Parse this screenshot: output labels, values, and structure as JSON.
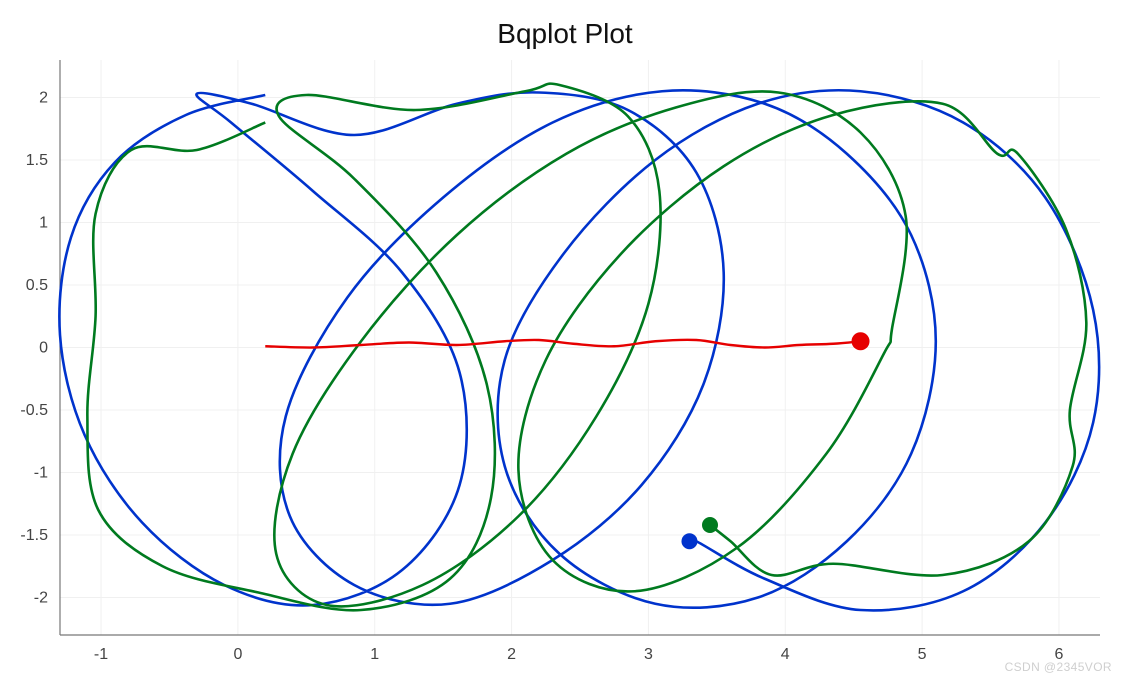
{
  "chart_data": {
    "type": "line",
    "title": "Bqplot Plot",
    "xlabel": "",
    "ylabel": "",
    "xlim": [
      -1.3,
      6.3
    ],
    "ylim": [
      -2.3,
      2.3
    ],
    "xticks": [
      -1,
      0,
      1,
      2,
      3,
      4,
      5,
      6
    ],
    "yticks": [
      -2,
      -1.5,
      -1,
      -0.5,
      0,
      0.5,
      1,
      1.5,
      2
    ],
    "grid": true,
    "series": [
      {
        "name": "blue",
        "color": "#0033cc",
        "notes": "Parametric epicycloid-like curve: roughly four overlapping loops spanning x≈-1 to x≈6, y≈-2.1 to y≈2.1. End-point marker at approx (3.3, -1.55).",
        "end_marker": {
          "x": 3.3,
          "y": -1.55
        },
        "values": [
          [
            0.2,
            2.02
          ],
          [
            -0.38,
            1.86
          ],
          [
            -0.9,
            1.48
          ],
          [
            -1.22,
            0.88
          ],
          [
            -1.3,
            0.1
          ],
          [
            -1.12,
            -0.7
          ],
          [
            -0.7,
            -1.4
          ],
          [
            -0.1,
            -1.9
          ],
          [
            0.55,
            -2.06
          ],
          [
            1.2,
            -1.78
          ],
          [
            1.62,
            -1.1
          ],
          [
            1.62,
            -0.2
          ],
          [
            1.2,
            0.6
          ],
          [
            0.55,
            1.25
          ],
          [
            -0.05,
            1.8
          ],
          [
            -0.3,
            2.03
          ],
          [
            0.1,
            1.95
          ],
          [
            0.85,
            1.7
          ],
          [
            1.6,
            1.95
          ],
          [
            2.2,
            2.04
          ],
          [
            2.85,
            1.9
          ],
          [
            3.35,
            1.4
          ],
          [
            3.55,
            0.6
          ],
          [
            3.4,
            -0.3
          ],
          [
            2.95,
            -1.1
          ],
          [
            2.3,
            -1.7
          ],
          [
            1.55,
            -2.05
          ],
          [
            0.85,
            -1.9
          ],
          [
            0.38,
            -1.35
          ],
          [
            0.35,
            -0.55
          ],
          [
            0.8,
            0.4
          ],
          [
            1.5,
            1.2
          ],
          [
            2.3,
            1.8
          ],
          [
            3.1,
            2.05
          ],
          [
            3.85,
            1.95
          ],
          [
            4.45,
            1.55
          ],
          [
            4.92,
            0.9
          ],
          [
            5.1,
            0.05
          ],
          [
            4.92,
            -0.85
          ],
          [
            4.45,
            -1.55
          ],
          [
            3.8,
            -2.0
          ],
          [
            3.05,
            -2.05
          ],
          [
            2.35,
            -1.65
          ],
          [
            1.95,
            -0.95
          ],
          [
            1.95,
            -0.1
          ],
          [
            2.38,
            0.75
          ],
          [
            3.05,
            1.5
          ],
          [
            3.8,
            1.95
          ],
          [
            4.55,
            2.05
          ],
          [
            5.3,
            1.8
          ],
          [
            5.9,
            1.2
          ],
          [
            6.25,
            0.3
          ],
          [
            6.25,
            -0.6
          ],
          [
            5.9,
            -1.4
          ],
          [
            5.3,
            -1.95
          ],
          [
            4.55,
            -2.1
          ],
          [
            3.85,
            -1.85
          ],
          [
            3.35,
            -1.55
          ],
          [
            3.3,
            -1.55
          ]
        ]
      },
      {
        "name": "green",
        "color": "#007a1f",
        "notes": "Second parametric curve, phase-shifted relative to blue; four-lobe looping curve with more irregular outline. End-point marker at approx (3.45, -1.42).",
        "end_marker": {
          "x": 3.45,
          "y": -1.42
        },
        "values": [
          [
            0.2,
            1.8
          ],
          [
            -0.3,
            1.58
          ],
          [
            -0.78,
            1.58
          ],
          [
            -1.04,
            1.07
          ],
          [
            -1.04,
            0.25
          ],
          [
            -1.1,
            -0.55
          ],
          [
            -1.02,
            -1.3
          ],
          [
            -0.55,
            -1.75
          ],
          [
            0.15,
            -1.96
          ],
          [
            0.9,
            -2.1
          ],
          [
            1.55,
            -1.85
          ],
          [
            1.85,
            -1.2
          ],
          [
            1.82,
            -0.3
          ],
          [
            1.45,
            0.6
          ],
          [
            0.85,
            1.35
          ],
          [
            0.3,
            1.85
          ],
          [
            0.5,
            2.02
          ],
          [
            1.3,
            1.9
          ],
          [
            2.1,
            2.05
          ],
          [
            2.35,
            2.1
          ],
          [
            2.85,
            1.85
          ],
          [
            3.08,
            1.25
          ],
          [
            3.0,
            0.35
          ],
          [
            2.62,
            -0.55
          ],
          [
            2.05,
            -1.35
          ],
          [
            1.35,
            -1.9
          ],
          [
            0.65,
            -2.06
          ],
          [
            0.28,
            -1.65
          ],
          [
            0.4,
            -0.85
          ],
          [
            0.9,
            0.05
          ],
          [
            1.6,
            0.9
          ],
          [
            2.4,
            1.55
          ],
          [
            3.2,
            1.92
          ],
          [
            3.95,
            2.04
          ],
          [
            4.55,
            1.72
          ],
          [
            4.88,
            1.05
          ],
          [
            4.78,
            0.15
          ],
          [
            4.72,
            -0.05
          ],
          [
            4.3,
            -0.85
          ],
          [
            3.65,
            -1.6
          ],
          [
            2.9,
            -1.95
          ],
          [
            2.3,
            -1.7
          ],
          [
            2.05,
            -0.98
          ],
          [
            2.25,
            -0.1
          ],
          [
            2.8,
            0.75
          ],
          [
            3.55,
            1.45
          ],
          [
            4.35,
            1.86
          ],
          [
            5.15,
            1.95
          ],
          [
            5.55,
            1.55
          ],
          [
            5.7,
            1.55
          ],
          [
            6.05,
            0.95
          ],
          [
            6.2,
            0.2
          ],
          [
            6.08,
            -0.5
          ],
          [
            6.1,
            -0.95
          ],
          [
            5.78,
            -1.55
          ],
          [
            5.15,
            -1.82
          ],
          [
            4.35,
            -1.73
          ],
          [
            3.9,
            -1.82
          ],
          [
            3.6,
            -1.55
          ],
          [
            3.45,
            -1.42
          ]
        ]
      },
      {
        "name": "red",
        "color": "#e60000",
        "notes": "Near-horizontal wavy line close to y=0, from x≈0.2 to x≈4.55. End-point marker at approx (4.55, 0.05).",
        "end_marker": {
          "x": 4.55,
          "y": 0.05
        },
        "values": [
          [
            0.2,
            0.01
          ],
          [
            0.55,
            0.0
          ],
          [
            0.9,
            0.02
          ],
          [
            1.25,
            0.04
          ],
          [
            1.6,
            0.02
          ],
          [
            1.95,
            0.05
          ],
          [
            2.2,
            0.06
          ],
          [
            2.45,
            0.03
          ],
          [
            2.75,
            0.01
          ],
          [
            3.05,
            0.05
          ],
          [
            3.35,
            0.06
          ],
          [
            3.6,
            0.02
          ],
          [
            3.85,
            0.0
          ],
          [
            4.1,
            0.02
          ],
          [
            4.35,
            0.03
          ],
          [
            4.55,
            0.05
          ]
        ]
      }
    ]
  },
  "watermark": "CSDN @2345VOR"
}
